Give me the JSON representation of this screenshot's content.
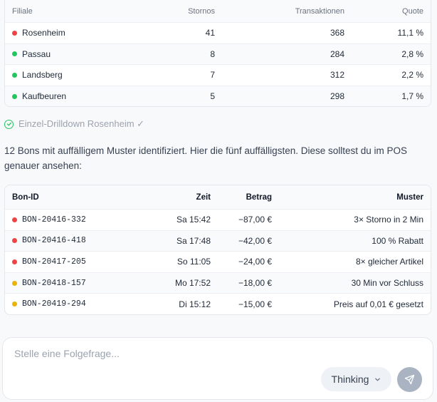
{
  "table1": {
    "columns": [
      "Filiale",
      "Stornos",
      "Transaktionen",
      "Quote"
    ],
    "rows": [
      {
        "filiale": "Rosenheim",
        "stornos": "41",
        "transaktionen": "368",
        "quote": "11,1 %",
        "status_color": "#ef4444"
      },
      {
        "filiale": "Passau",
        "stornos": "8",
        "transaktionen": "284",
        "quote": "2,8 %",
        "status_color": "#22c55e"
      },
      {
        "filiale": "Landsberg",
        "stornos": "7",
        "transaktionen": "312",
        "quote": "2,2 %",
        "status_color": "#22c55e"
      },
      {
        "filiale": "Kaufbeuren",
        "stornos": "5",
        "transaktionen": "298",
        "quote": "1,7 %",
        "status_color": "#22c55e"
      }
    ]
  },
  "drilldown": {
    "label": "Einzel-Drilldown Rosenheim ✓",
    "icon": "check-circle-icon"
  },
  "message": {
    "text": "12 Bons mit auffälligem Muster identifiziert. Hier die fünf auffälligsten. Diese solltest du im POS genauer ansehen:"
  },
  "table2": {
    "columns": [
      "Bon-ID",
      "Zeit",
      "Betrag",
      "Muster"
    ],
    "rows": [
      {
        "bon_id": "BON-20416-332",
        "zeit": "Sa 15:42",
        "betrag": "−87,00 €",
        "muster": "3× Storno in 2 Min",
        "status_color": "#ef4444"
      },
      {
        "bon_id": "BON-20416-418",
        "zeit": "Sa 17:48",
        "betrag": "−42,00 €",
        "muster": "100 % Rabatt",
        "status_color": "#ef4444"
      },
      {
        "bon_id": "BON-20417-205",
        "zeit": "So 11:05",
        "betrag": "−24,00 €",
        "muster": "8× gleicher Artikel",
        "status_color": "#ef4444"
      },
      {
        "bon_id": "BON-20418-157",
        "zeit": "Mo 17:52",
        "betrag": "−18,00 €",
        "muster": "30 Min vor Schluss",
        "status_color": "#eab308"
      },
      {
        "bon_id": "BON-20419-294",
        "zeit": "Di 15:12",
        "betrag": "−15,00 €",
        "muster": "Preis auf 0,01 € gesetzt",
        "status_color": "#eab308"
      }
    ]
  },
  "composer": {
    "placeholder": "Stelle eine Folgefrage...",
    "value": "",
    "mode_label": "Thinking",
    "send_icon": "send-icon",
    "mode_icon": "chevron-down-icon"
  },
  "colors": {
    "red": "#ef4444",
    "green": "#22c55e",
    "amber": "#eab308",
    "send_button": "#aab3c2"
  }
}
